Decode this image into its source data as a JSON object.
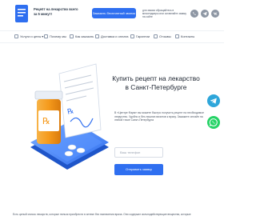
{
  "header": {
    "logo_text": "Рецепт на лекарство всего за 5 минут!",
    "cta_label": "Заказать бесплатный звонок",
    "note": "для заказа обращайтесь в мессенджеры или оставляйте заявку на сайте"
  },
  "nav": {
    "items": [
      {
        "label": "Услуги и цены ▾"
      },
      {
        "label": "Почему мы"
      },
      {
        "label": "Как заказать"
      },
      {
        "label": "Доставка и оплата"
      },
      {
        "label": "Гарантии"
      },
      {
        "label": "Отзывы"
      },
      {
        "label": "Контакты"
      }
    ]
  },
  "hero": {
    "title_line1": "Купить рецепт на лекарство",
    "title_line2": "в Санкт-Петербурге",
    "description": "В «Центре Фарм» вы можете быстро получить рецепт на необходимое лекарство. Удобно и без лишних визитов к врачу. Закажите онлайн на любой точке Санкт-Петербурга",
    "input_placeholder": "Ваш телефон",
    "submit_label": "Отправить заявку"
  },
  "footer": {
    "text": "Есть целый список лекарств, которые нельзя приобрести в аптеке без назначения врача. Они содержат сильнодействующие вещества, которые"
  },
  "colors": {
    "accent": "#2f6ff0",
    "telegram": "#2ea6da",
    "whatsapp": "#25d366",
    "bottle": "#f59a1c"
  },
  "icons": {
    "logo": "prescription-document-icon",
    "social": [
      "whatsapp-icon",
      "telegram-icon",
      "vk-icon"
    ],
    "float": [
      "telegram-icon",
      "whatsapp-icon"
    ]
  }
}
